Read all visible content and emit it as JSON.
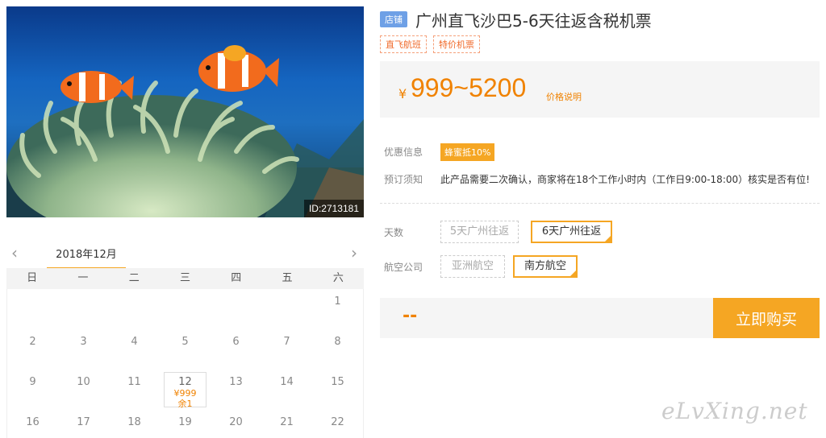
{
  "hero": {
    "id_label": "ID:2713181"
  },
  "calendar": {
    "prev_icon": "chevron-left-icon",
    "next_icon": "chevron-right-icon",
    "month": "2018年12月",
    "weekdays": [
      "日",
      "一",
      "二",
      "三",
      "四",
      "五",
      "六"
    ],
    "days": {
      "d1": "1",
      "d2": "2",
      "d3": "3",
      "d4": "4",
      "d5": "5",
      "d6": "6",
      "d7": "7",
      "d8": "8",
      "d9": "9",
      "d10": "10",
      "d11": "11",
      "d12": "12",
      "d13": "13",
      "d14": "14",
      "d15": "15",
      "d16": "16",
      "d17": "17",
      "d18": "18",
      "d19": "19",
      "d20": "20",
      "d21": "21",
      "d22": "22"
    },
    "d12_price": "¥999",
    "d12_remain": "余1"
  },
  "product": {
    "shop_badge": "店铺",
    "title": "广州直飞沙巴5-6天往返含税机票",
    "tags": [
      "直飞航班",
      "特价机票"
    ],
    "price_currency": "¥",
    "price_range": "999~5200",
    "price_note": "价格说明",
    "promo_label": "优惠信息",
    "promo_badge": "蜂蜜抵10%",
    "notice_label": "预订须知",
    "notice_text": "此产品需要二次确认，商家将在18个工作小时内（工作日9:00-18:00）核实是否有位!",
    "days_label": "天数",
    "days_options": [
      "5天广州往返",
      "6天广州往返"
    ],
    "airline_label": "航空公司",
    "airline_options": [
      "亚洲航空",
      "南方航空"
    ],
    "total_price": "--",
    "buy_label": "立即购买"
  },
  "watermark": "eLvXing.net",
  "colors": {
    "accent": "#f5a623",
    "price": "#f08200",
    "shop_badge": "#6ea0e6"
  }
}
